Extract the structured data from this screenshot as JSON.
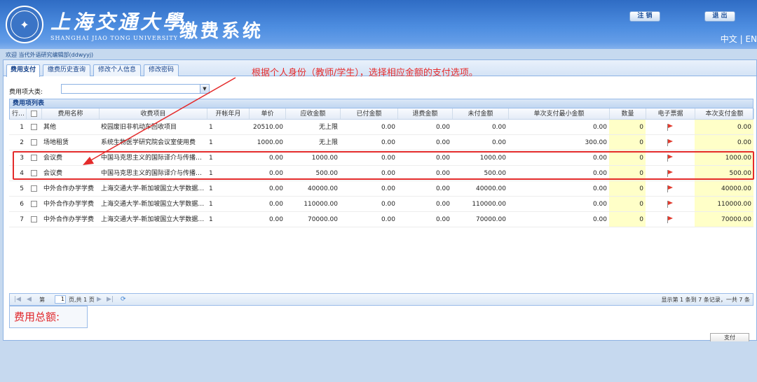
{
  "header": {
    "univ_cn": "上海交通大學",
    "univ_en": "SHANGHAI JIAO TONG UNIVERSITY",
    "system_title": "缴费系统",
    "logout_label": "注 销",
    "exit_label": "退 出",
    "lang": "中文 | EN"
  },
  "welcome": "欢迎 当代外语研究编辑部(ddwyyj)",
  "tabs": [
    "费用支付",
    "缴费历史查询",
    "修改个人信息",
    "修改密码"
  ],
  "annotation": "根据个人身份（教师/学生），选择相应金额的支付选项。",
  "filter": {
    "label": "费用项大类:",
    "value": ""
  },
  "panel_title": "费用项列表",
  "columns": [
    "行号",
    "",
    "费用名称",
    "收费项目",
    "开帐年月",
    "单价",
    "应收金额",
    "已付金额",
    "退费金额",
    "未付金额",
    "单次支付最小金额",
    "数量",
    "电子票据",
    "本次支付金额"
  ],
  "rows": [
    {
      "no": "1",
      "name": "其他",
      "item": "校园废旧非机动车回收项目",
      "period": "1",
      "price": "20510.00",
      "due": "无上限",
      "paid": "0.00",
      "refund": "0.00",
      "unpaid": "0.00",
      "min": "0.00",
      "qty": "0",
      "pay": "0.00"
    },
    {
      "no": "2",
      "name": "场地租赁",
      "item": "系统生物医学研究院会议室使用费",
      "period": "1",
      "price": "1000.00",
      "due": "无上限",
      "paid": "0.00",
      "refund": "0.00",
      "unpaid": "0.00",
      "min": "300.00",
      "qty": "0",
      "pay": "0.00"
    },
    {
      "no": "3",
      "name": "会议费",
      "item": "中国马克思主义的国际译介与传播研讨会",
      "period": "1",
      "price": "0.00",
      "due": "1000.00",
      "paid": "0.00",
      "refund": "0.00",
      "unpaid": "1000.00",
      "min": "0.00",
      "qty": "0",
      "pay": "1000.00"
    },
    {
      "no": "4",
      "name": "会议费",
      "item": "中国马克思主义的国际译介与传播研讨会",
      "period": "1",
      "price": "0.00",
      "due": "500.00",
      "paid": "0.00",
      "refund": "0.00",
      "unpaid": "500.00",
      "min": "0.00",
      "qty": "0",
      "pay": "500.00"
    },
    {
      "no": "5",
      "name": "中外合作办学学费",
      "item": "上海交通大学-新加坡国立大学数据科学",
      "period": "1",
      "price": "0.00",
      "due": "40000.00",
      "paid": "0.00",
      "refund": "0.00",
      "unpaid": "40000.00",
      "min": "0.00",
      "qty": "0",
      "pay": "40000.00"
    },
    {
      "no": "6",
      "name": "中外合作办学学费",
      "item": "上海交通大学-新加坡国立大学数据科学",
      "period": "1",
      "price": "0.00",
      "due": "110000.00",
      "paid": "0.00",
      "refund": "0.00",
      "unpaid": "110000.00",
      "min": "0.00",
      "qty": "0",
      "pay": "110000.00"
    },
    {
      "no": "7",
      "name": "中外合作办学学费",
      "item": "上海交通大学-新加坡国立大学数据科学",
      "period": "1",
      "price": "0.00",
      "due": "70000.00",
      "paid": "0.00",
      "refund": "0.00",
      "unpaid": "70000.00",
      "min": "0.00",
      "qty": "0",
      "pay": "70000.00"
    }
  ],
  "pager": {
    "page_prefix": "第",
    "page_value": "1",
    "page_suffix": "页,共 1 页",
    "info": "显示第 1 条到 7 条记录，一共 7 条"
  },
  "total_label": "费用总额:",
  "pay_label": "支付",
  "colors": {
    "header": "#3a78cc",
    "annotation": "#e62d2d",
    "highlight": "#e42b2b",
    "editable": "#ffffc8"
  }
}
